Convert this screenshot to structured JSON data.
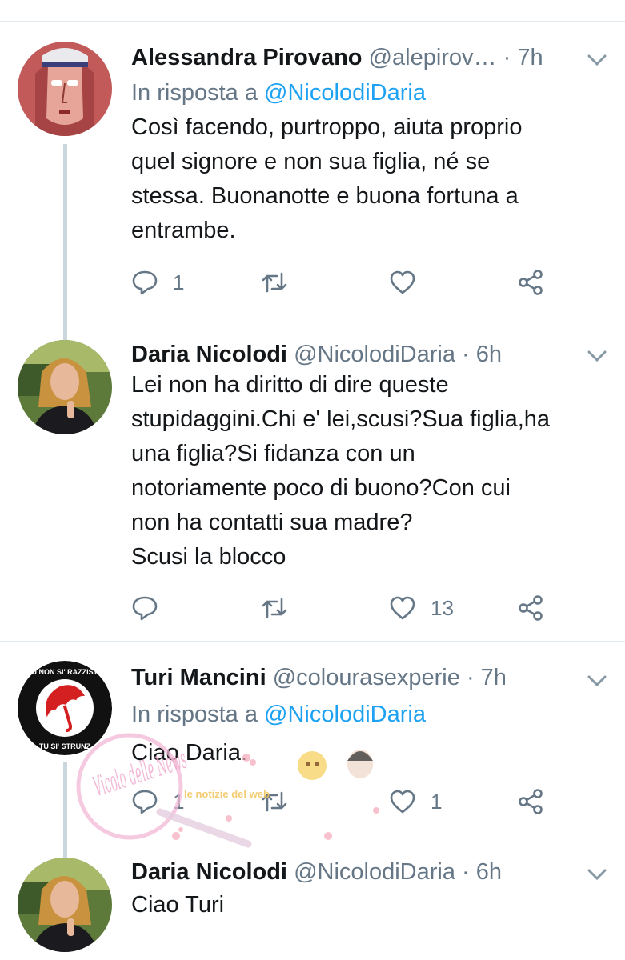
{
  "tweets": [
    {
      "name": "Alessandra Pirovano",
      "handle": "@alepirov…",
      "time": "· 7h",
      "reply_label": "In risposta a",
      "reply_mention": "@NicolodiDaria",
      "text_lines": [
        "Così facendo, purtroppo, aiuta proprio",
        "quel signore e non sua figlia, né se",
        "stessa. Buonanotte e buona fortuna a",
        "entrambe."
      ],
      "reply_count": "1",
      "retweet_count": "",
      "like_count": ""
    },
    {
      "name": "Daria Nicolodi",
      "handle": "@NicolodiDaria",
      "time": "· 6h",
      "text_lines": [
        "Lei non ha diritto di dire queste",
        "stupidaggini.Chi e' lei,scusi?Sua figlia,ha",
        "una figlia?Si fidanza con un",
        "notoriamente poco di buono?Con cui",
        "non ha contatti sua madre?",
        "Scusi la blocco"
      ],
      "reply_count": "",
      "retweet_count": "",
      "like_count": "13"
    },
    {
      "name": "Turi Mancini",
      "handle": "@colourasexperie",
      "time": "· 7h",
      "reply_label": "In risposta a",
      "reply_mention": "@NicolodiDaria",
      "text_lines": [
        "Ciao Daria."
      ],
      "reply_count": "1",
      "retweet_count": "",
      "like_count": "1",
      "avatar_text_top": "TU NON SI' RAZZISTA",
      "avatar_text_bottom": "TU SI' STRUNZ"
    },
    {
      "name": "Daria Nicolodi",
      "handle": "@NicolodiDaria",
      "time": "· 6h",
      "text_lines": [
        "Ciao Turi"
      ]
    }
  ],
  "colors": {
    "link": "#1da1f2",
    "secondary": "#657786",
    "thread_line": "#ccd6dd",
    "divider": "#e1e8ed"
  },
  "watermark": {
    "text": "Vicolo delle News",
    "sub": "le notizie del web"
  }
}
